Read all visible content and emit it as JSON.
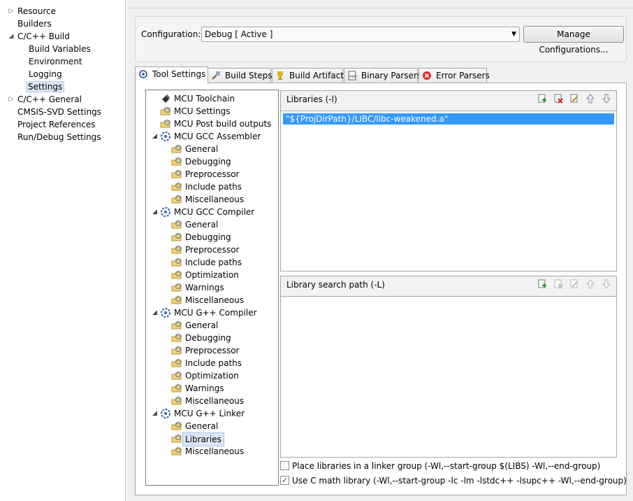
{
  "left_tree": {
    "items": [
      {
        "label": "Resource",
        "arrow": "▷"
      },
      {
        "label": "Builders",
        "arrow": ""
      },
      {
        "label": "C/C++ Build",
        "arrow": "◢"
      },
      {
        "label": "Build Variables",
        "arrow": ""
      },
      {
        "label": "Environment",
        "arrow": ""
      },
      {
        "label": "Logging",
        "arrow": ""
      },
      {
        "label": "Settings",
        "arrow": ""
      },
      {
        "label": "C/C++ General",
        "arrow": "▷"
      },
      {
        "label": "CMSIS-SVD Settings",
        "arrow": ""
      },
      {
        "label": "Project References",
        "arrow": ""
      },
      {
        "label": "Run/Debug Settings",
        "arrow": ""
      }
    ]
  },
  "configuration": {
    "label": "Configuration:",
    "value": "Debug  [ Active ]",
    "manage_button": "Manage Configurations..."
  },
  "tabs": [
    {
      "label": "Tool Settings",
      "icon": "tool-settings-icon"
    },
    {
      "label": "Build Steps",
      "icon": "build-steps-icon"
    },
    {
      "label": "Build Artifact",
      "icon": "build-artifact-icon"
    },
    {
      "label": "Binary Parsers",
      "icon": "binary-parsers-icon"
    },
    {
      "label": "Error Parsers",
      "icon": "error-parsers-icon"
    }
  ],
  "tool_tree": [
    {
      "label": "MCU Toolchain",
      "arrow": ""
    },
    {
      "label": "MCU Settings",
      "arrow": ""
    },
    {
      "label": "MCU Post build outputs",
      "arrow": ""
    },
    {
      "label": "MCU GCC Assembler",
      "arrow": "◢"
    },
    {
      "label": "General",
      "arrow": ""
    },
    {
      "label": "Debugging",
      "arrow": ""
    },
    {
      "label": "Preprocessor",
      "arrow": ""
    },
    {
      "label": "Include paths",
      "arrow": ""
    },
    {
      "label": "Miscellaneous",
      "arrow": ""
    },
    {
      "label": "MCU GCC Compiler",
      "arrow": "◢"
    },
    {
      "label": "General",
      "arrow": ""
    },
    {
      "label": "Debugging",
      "arrow": ""
    },
    {
      "label": "Preprocessor",
      "arrow": ""
    },
    {
      "label": "Include paths",
      "arrow": ""
    },
    {
      "label": "Optimization",
      "arrow": ""
    },
    {
      "label": "Warnings",
      "arrow": ""
    },
    {
      "label": "Miscellaneous",
      "arrow": ""
    },
    {
      "label": "MCU G++ Compiler",
      "arrow": "◢"
    },
    {
      "label": "General",
      "arrow": ""
    },
    {
      "label": "Debugging",
      "arrow": ""
    },
    {
      "label": "Preprocessor",
      "arrow": ""
    },
    {
      "label": "Include paths",
      "arrow": ""
    },
    {
      "label": "Optimization",
      "arrow": ""
    },
    {
      "label": "Warnings",
      "arrow": ""
    },
    {
      "label": "Miscellaneous",
      "arrow": ""
    },
    {
      "label": "MCU G++ Linker",
      "arrow": "◢"
    },
    {
      "label": "General",
      "arrow": ""
    },
    {
      "label": "Libraries",
      "arrow": ""
    },
    {
      "label": "Miscellaneous",
      "arrow": ""
    }
  ],
  "libraries_panel": {
    "title": "Libraries (-l)",
    "items": [
      "\"${ProjDirPath}/LIBC/libc-weakened.a\""
    ]
  },
  "search_path_panel": {
    "title": "Library search path (-L)",
    "items": []
  },
  "options": {
    "linker_group": {
      "label": "Place libraries in a linker group (-Wl,--start-group $(LIBS) -Wl,--end-group)",
      "checked": false
    },
    "c_math": {
      "label": "Use C math library (-Wl,--start-group -lc -lm -lstdc++ -lsupc++ -Wl,--end-group)",
      "checked": true
    }
  },
  "colors": {
    "selection": "#3399ff",
    "tree_selection": "#dce7f6"
  }
}
